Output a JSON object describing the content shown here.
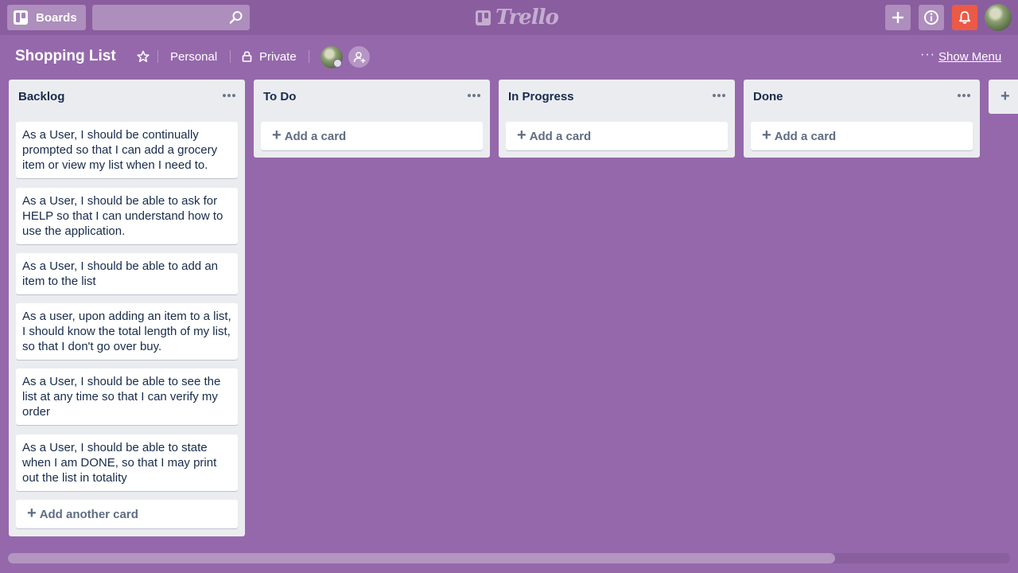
{
  "header": {
    "boards_label": "Boards",
    "search_placeholder": "",
    "logo_text": "Trello"
  },
  "board": {
    "title": "Shopping List",
    "team": "Personal",
    "visibility": "Private",
    "show_menu": "Show Menu"
  },
  "lists": [
    {
      "title": "Backlog",
      "cards": [
        "As a User, I should be continually prompted so that I can add a grocery item or view my list when I need to.",
        "As a User, I should be able to ask for HELP so that I can understand how to use the application.",
        "As a User, I should be able to add an item to the list",
        "As a user, upon adding an item to a list, I should know the total length of my list, so that I don't go over buy.",
        "As a User, I should be able to see the list at any time so that I can verify my order",
        "As a User, I should be able to state when I am DONE, so that I may print out the list in totality"
      ],
      "add_label": "Add another card"
    },
    {
      "title": "To Do",
      "cards": [],
      "add_label": "Add a card"
    },
    {
      "title": "In Progress",
      "cards": [],
      "add_label": "Add a card"
    },
    {
      "title": "Done",
      "cards": [],
      "add_label": "Add a card"
    }
  ],
  "colors": {
    "board_background": "#9568ac",
    "notification": "#eb5a46",
    "list_background": "#ebecf0"
  },
  "icons": [
    "boards-icon",
    "search-icon",
    "trello-logo-icon",
    "plus-icon",
    "info-icon",
    "bell-icon",
    "star-icon",
    "lock-icon",
    "add-member-icon",
    "ellipsis-icon"
  ]
}
